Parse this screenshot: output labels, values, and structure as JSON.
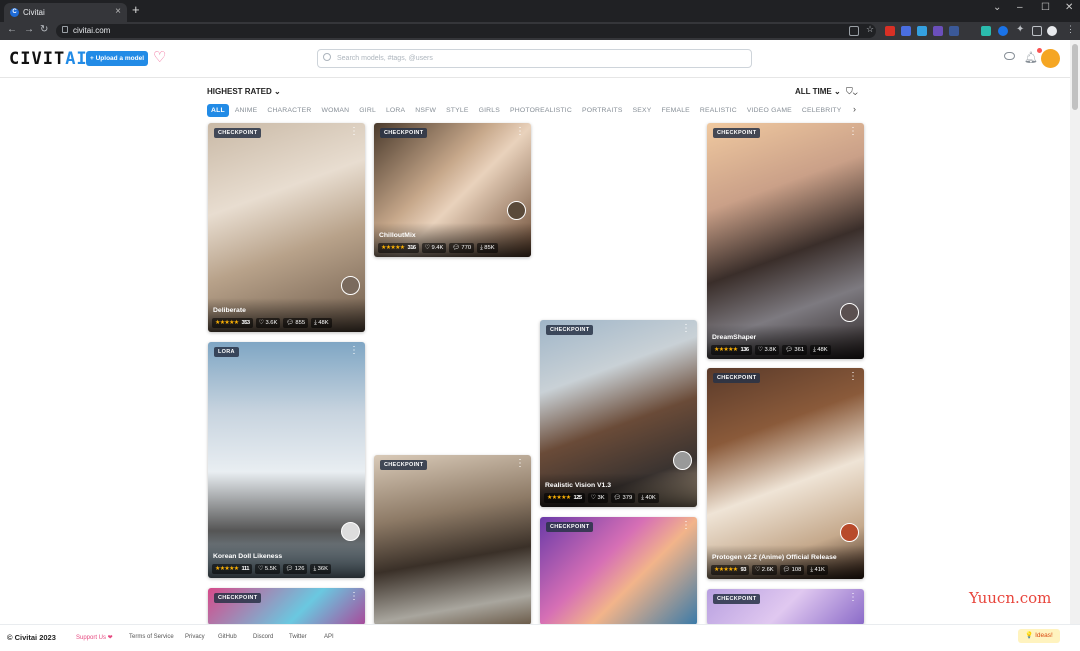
{
  "browser": {
    "tab_title": "Civitai",
    "url": "civitai.com",
    "new_tab": "+",
    "favicon": "C",
    "close": "×"
  },
  "header": {
    "logo_main": "CIVIT",
    "logo_accent": "AI",
    "upload_label": "+ Upload a model",
    "search_placeholder": "Search models, #tags, @users",
    "accent": "#228be6"
  },
  "filters": {
    "sort": "HIGHEST RATED",
    "period": "ALL TIME",
    "tags": [
      "ALL",
      "ANIME",
      "CHARACTER",
      "WOMAN",
      "GIRL",
      "LORA",
      "NSFW",
      "STYLE",
      "GIRLS",
      "PHOTOREALISTIC",
      "PORTRAITS",
      "SEXY",
      "FEMALE",
      "REALISTIC",
      "VIDEO GAME",
      "CELEBRITY"
    ],
    "active_tag": "ALL"
  },
  "cards": [
    {
      "badge": "CHECKPOINT",
      "name": "Deliberate",
      "rating": "353",
      "likes": "3.6K",
      "comments": "855",
      "downloads": "48K"
    },
    {
      "badge": "CHECKPOINT",
      "name": "ChilloutMix",
      "rating": "316",
      "likes": "9.4K",
      "comments": "770",
      "downloads": "85K"
    },
    {
      "badge": "CHECKPOINT",
      "name": "DreamShaper",
      "rating": "136",
      "likes": "3.8K",
      "comments": "361",
      "downloads": "48K"
    },
    {
      "badge": "LORA",
      "name": "Korean Doll Likeness",
      "rating": "111",
      "likes": "5.5K",
      "comments": "126",
      "downloads": "36K"
    },
    {
      "badge": "CHECKPOINT",
      "name": "Realistic Vision V1.3",
      "rating": "125",
      "likes": "3K",
      "comments": "379",
      "downloads": "40K"
    },
    {
      "badge": "CHECKPOINT",
      "name": "Protogen v2.2 (Anime) Official Release",
      "rating": "93",
      "likes": "2.6K",
      "comments": "108",
      "downloads": "41K"
    },
    {
      "badge": "CHECKPOINT"
    },
    {
      "badge": "CHECKPOINT"
    },
    {
      "badge": "CHECKPOINT"
    },
    {
      "badge": "CHECKPOINT"
    }
  ],
  "stars": "★★★★★",
  "footer": {
    "copyright": "© Civitai 2023",
    "support": "Support Us ❤",
    "terms": "Terms of Service",
    "privacy": "Privacy",
    "github": "GitHub",
    "discord": "Discord",
    "twitter": "Twitter",
    "api": "API",
    "ideas": "💡 Ideas!"
  },
  "watermark": "Yuucn.com"
}
